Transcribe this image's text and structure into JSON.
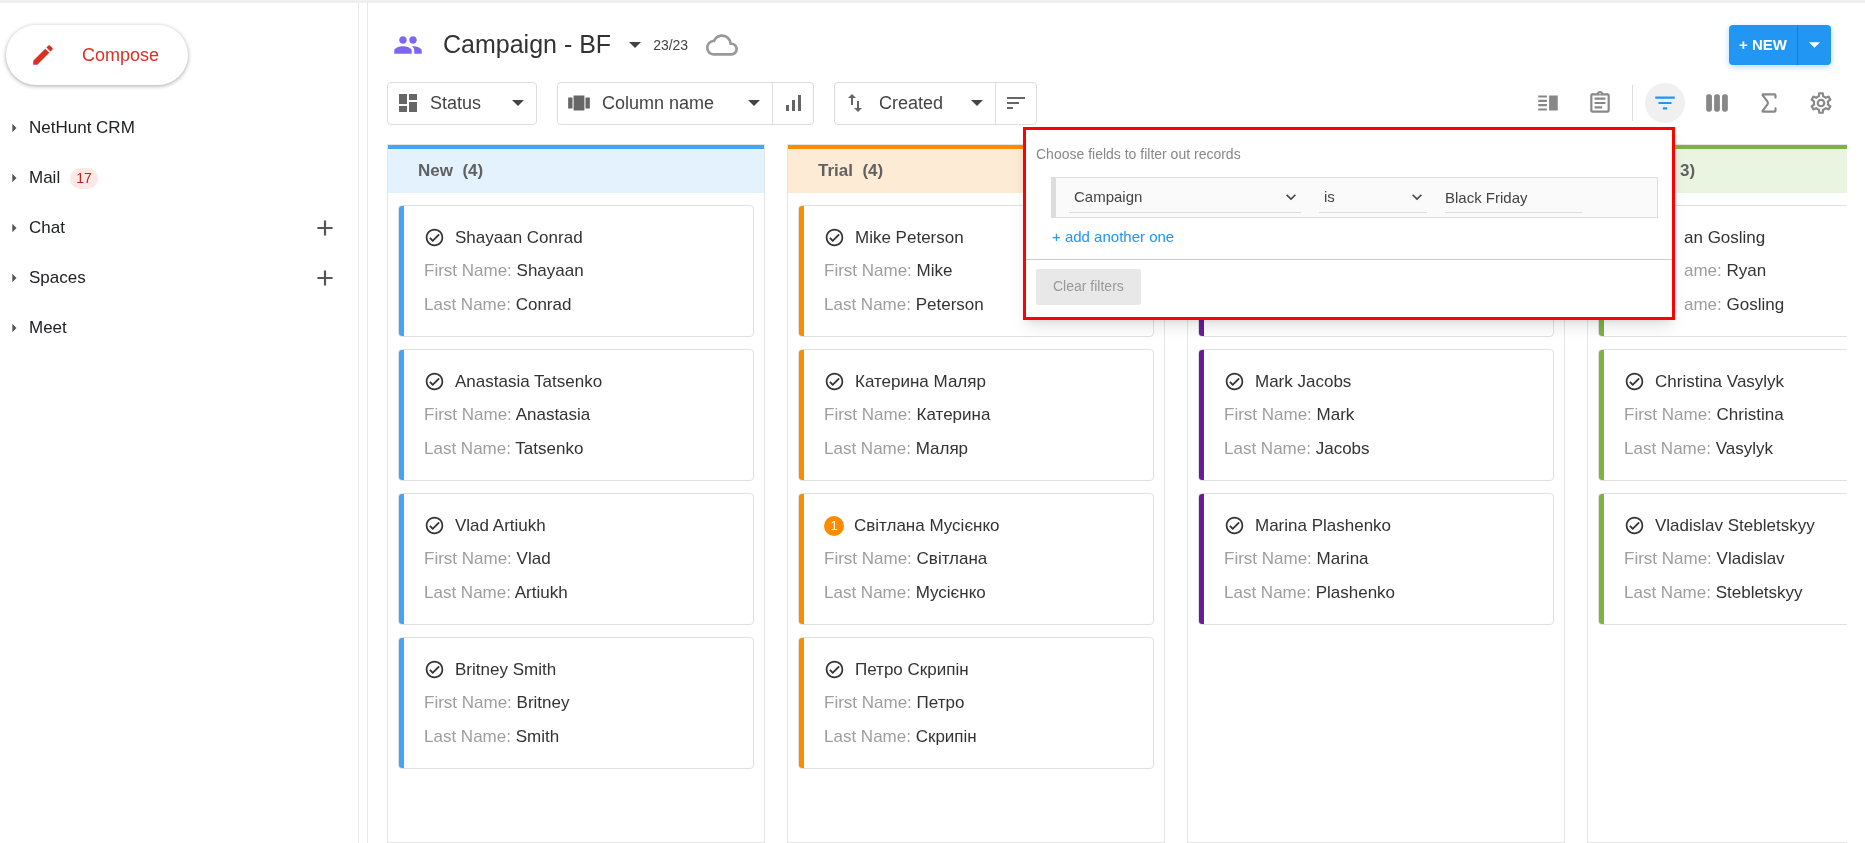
{
  "sidebar": {
    "compose": "Compose",
    "items": [
      {
        "label": "NetHunt CRM",
        "expanded": false
      },
      {
        "label": "Mail",
        "badge": "17",
        "expanded": false
      },
      {
        "label": "Chat",
        "expanded": false,
        "add_button": true
      },
      {
        "label": "Spaces",
        "expanded": false,
        "add_button": true
      },
      {
        "label": "Meet",
        "expanded": false
      }
    ]
  },
  "header": {
    "title": "Campaign - BF",
    "count": "23/23",
    "new_button": "+ NEW"
  },
  "toolbar": {
    "group_by": "Status",
    "column_field": "Column name",
    "sort_by": "Created"
  },
  "view_tools": [
    {
      "kind": "layout",
      "selected": false
    },
    {
      "kind": "clipboard",
      "selected": false
    },
    {
      "kind": "filter",
      "selected": true
    },
    {
      "kind": "columns",
      "selected": false
    },
    {
      "kind": "sum",
      "selected": false
    },
    {
      "kind": "settings",
      "selected": false
    }
  ],
  "filter_popup": {
    "hint": "Choose fields to filter out records",
    "rules": [
      {
        "field": "Campaign",
        "operator": "is",
        "value": "Black Friday"
      }
    ],
    "add_link": "+ add another one",
    "clear_button": "Clear filters"
  },
  "columns": [
    {
      "title": "New",
      "count": "(4)",
      "color": "#42a5f5",
      "cards": [
        {
          "kind": "check",
          "name": "Shayaan Conrad",
          "fields": [
            {
              "label": "First Name:",
              "value": "Shayaan"
            },
            {
              "label": "Last Name:",
              "value": "Conrad"
            }
          ]
        },
        {
          "kind": "check",
          "name": "Anastasia Tatsenko",
          "fields": [
            {
              "label": "First Name:",
              "value": "Anastasia"
            },
            {
              "label": "Last Name:",
              "value": "Tatsenko"
            }
          ]
        },
        {
          "kind": "check",
          "name": "Vlad Artiukh",
          "fields": [
            {
              "label": "First Name:",
              "value": "Vlad"
            },
            {
              "label": "Last Name:",
              "value": "Artiukh"
            }
          ]
        },
        {
          "kind": "check",
          "name": "Britney Smith",
          "fields": [
            {
              "label": "First Name:",
              "value": "Britney"
            },
            {
              "label": "Last Name:",
              "value": "Smith"
            }
          ]
        }
      ]
    },
    {
      "title": "Trial",
      "count": "(4)",
      "color": "#fb8c00",
      "cards": [
        {
          "kind": "check",
          "name": "Mike Peterson",
          "fields": [
            {
              "label": "First Name:",
              "value": "Mike"
            },
            {
              "label": "Last Name:",
              "value": "Peterson"
            }
          ]
        },
        {
          "kind": "check",
          "name": "Катерина Маляр",
          "fields": [
            {
              "label": "First Name:",
              "value": "Катерина"
            },
            {
              "label": "Last Name:",
              "value": "Маляр"
            }
          ]
        },
        {
          "kind": "count",
          "badge": "1",
          "name": "Світлана Мусієнко",
          "fields": [
            {
              "label": "First Name:",
              "value": "Світлана"
            },
            {
              "label": "Last Name:",
              "value": "Мусієнко"
            }
          ]
        },
        {
          "kind": "check",
          "name": "Петро Скрипін",
          "fields": [
            {
              "label": "First Name:",
              "value": "Петро"
            },
            {
              "label": "Last Name:",
              "value": "Скрипін"
            }
          ]
        }
      ]
    },
    {
      "color": "#6a1b9a",
      "cards": [
        {
          "kind": "blank"
        },
        {
          "kind": "check",
          "name": "Mark Jacobs",
          "fields": [
            {
              "label": "First Name:",
              "value": "Mark"
            },
            {
              "label": "Last Name:",
              "value": "Jacobs"
            }
          ]
        },
        {
          "kind": "check",
          "name": "Marina Plashenko",
          "fields": [
            {
              "label": "First Name:",
              "value": "Marina"
            },
            {
              "label": "Last Name:",
              "value": "Plashenko"
            }
          ]
        }
      ]
    },
    {
      "count": "3)",
      "color": "#7cb342",
      "cards": [
        {
          "kind": "cut",
          "name": "an Gosling",
          "fields": [
            {
              "label": "ame:",
              "value": "Ryan"
            },
            {
              "label": "ame:",
              "value": "Gosling"
            }
          ]
        },
        {
          "kind": "check",
          "name": "Christina Vasylyk",
          "fields": [
            {
              "label": "First Name:",
              "value": "Christina"
            },
            {
              "label": "Last Name:",
              "value": "Vasylyk"
            }
          ]
        },
        {
          "kind": "check",
          "name": "Vladislav Stebletskyy",
          "fields": [
            {
              "label": "First Name:",
              "value": "Vladislav"
            },
            {
              "label": "Last Name:",
              "value": "Stebletskyy"
            }
          ]
        }
      ]
    }
  ]
}
